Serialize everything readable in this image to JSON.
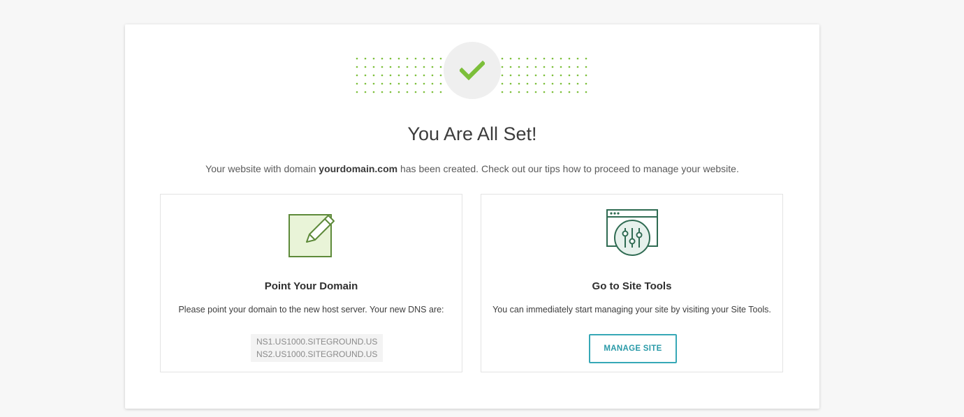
{
  "main": {
    "title": "You Are All Set!",
    "subtitle_prefix": "Your website with domain ",
    "domain": "yourdomain.com",
    "subtitle_suffix": " has been created. Check out our tips how to proceed to manage your website."
  },
  "cards": {
    "point_domain": {
      "icon": "edit-note-icon",
      "title": "Point Your Domain",
      "text": "Please point your domain to the new host server. Your new DNS are:",
      "dns": [
        "NS1.US1000.SITEGROUND.US",
        "NS2.US1000.SITEGROUND.US"
      ]
    },
    "site_tools": {
      "icon": "site-tools-icon",
      "title": "Go to Site Tools",
      "text": "You can immediately start managing your site by visiting your Site Tools.",
      "button_label": "MANAGE SITE"
    }
  },
  "colors": {
    "accent_green": "#7cbf3a",
    "button_teal": "#36a8b6",
    "icon_dark_green": "#2f6b52"
  }
}
